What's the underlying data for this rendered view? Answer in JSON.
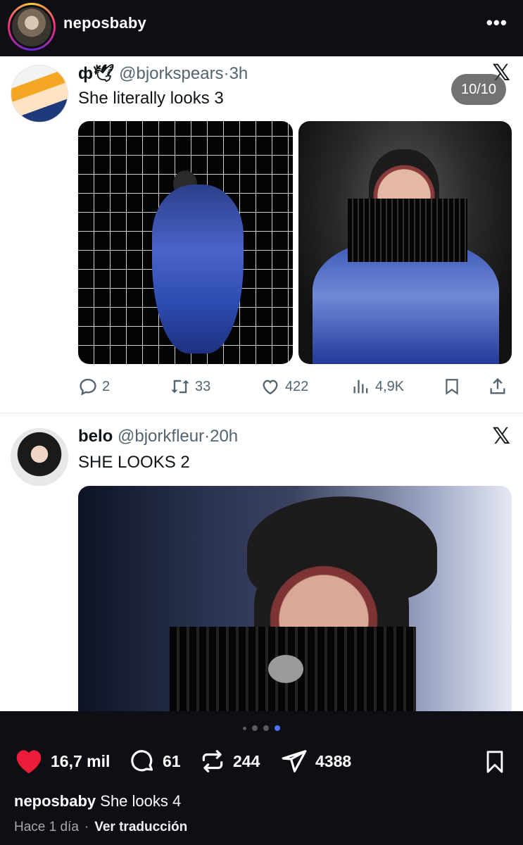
{
  "post": {
    "username": "neposbaby",
    "more_label": "•••"
  },
  "tweet1": {
    "display_name": "ф🕊",
    "handle": "@bjorkspears",
    "time": "3h",
    "text": "She literally looks 3",
    "photo_counter": "10/10",
    "replies": "2",
    "retweets": "33",
    "likes": "422",
    "views": "4,9K"
  },
  "tweet2": {
    "display_name": "belo",
    "handle": "@bjorkfleur",
    "time": "20h",
    "text": "SHE LOOKS 2"
  },
  "x_logo": "𝕏",
  "carousel": {
    "total_dots": 4,
    "active_index": 3
  },
  "engagement": {
    "likes": "16,7 mil",
    "comments": "61",
    "reposts": "244",
    "shares": "4388"
  },
  "caption": {
    "username": "neposbaby",
    "text": "She looks 4"
  },
  "meta": {
    "time": "Hace 1 día",
    "separator": "·",
    "translate": "Ver traducción"
  },
  "colors": {
    "like_red": "#ed1c3a",
    "active_dot": "#4a74ff",
    "bg_dark": "#0d0f14"
  }
}
